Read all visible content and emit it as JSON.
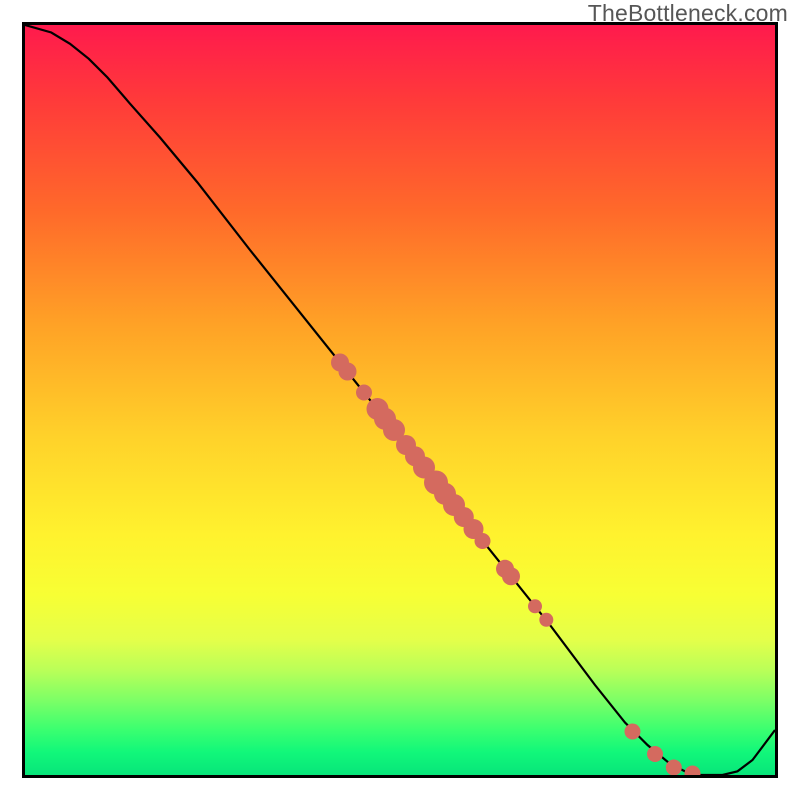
{
  "watermark": "TheBottleneck.com",
  "chart_data": {
    "type": "line",
    "title": "",
    "xlabel": "",
    "ylabel": "",
    "xlim": [
      0,
      1
    ],
    "ylim": [
      0,
      1
    ],
    "curve": [
      {
        "x": 0.0,
        "y": 1.0
      },
      {
        "x": 0.035,
        "y": 0.99
      },
      {
        "x": 0.06,
        "y": 0.975
      },
      {
        "x": 0.085,
        "y": 0.955
      },
      {
        "x": 0.11,
        "y": 0.93
      },
      {
        "x": 0.14,
        "y": 0.895
      },
      {
        "x": 0.18,
        "y": 0.85
      },
      {
        "x": 0.23,
        "y": 0.79
      },
      {
        "x": 0.3,
        "y": 0.7
      },
      {
        "x": 0.4,
        "y": 0.575
      },
      {
        "x": 0.5,
        "y": 0.45
      },
      {
        "x": 0.6,
        "y": 0.325
      },
      {
        "x": 0.7,
        "y": 0.2
      },
      {
        "x": 0.76,
        "y": 0.12
      },
      {
        "x": 0.8,
        "y": 0.07
      },
      {
        "x": 0.83,
        "y": 0.04
      },
      {
        "x": 0.86,
        "y": 0.015
      },
      {
        "x": 0.88,
        "y": 0.005
      },
      {
        "x": 0.9,
        "y": 0.0
      },
      {
        "x": 0.93,
        "y": 0.0
      },
      {
        "x": 0.95,
        "y": 0.005
      },
      {
        "x": 0.97,
        "y": 0.02
      },
      {
        "x": 0.985,
        "y": 0.04
      },
      {
        "x": 1.0,
        "y": 0.06
      }
    ],
    "points_group_a": [
      {
        "x": 0.42,
        "y": 0.55,
        "r": 9
      },
      {
        "x": 0.43,
        "y": 0.538,
        "r": 9
      },
      {
        "x": 0.452,
        "y": 0.51,
        "r": 8
      },
      {
        "x": 0.47,
        "y": 0.488,
        "r": 11
      },
      {
        "x": 0.48,
        "y": 0.475,
        "r": 11
      },
      {
        "x": 0.492,
        "y": 0.46,
        "r": 11
      },
      {
        "x": 0.508,
        "y": 0.44,
        "r": 10
      },
      {
        "x": 0.52,
        "y": 0.425,
        "r": 10
      },
      {
        "x": 0.532,
        "y": 0.41,
        "r": 11
      },
      {
        "x": 0.548,
        "y": 0.39,
        "r": 12
      },
      {
        "x": 0.56,
        "y": 0.375,
        "r": 11
      },
      {
        "x": 0.572,
        "y": 0.36,
        "r": 11
      },
      {
        "x": 0.585,
        "y": 0.344,
        "r": 10
      },
      {
        "x": 0.598,
        "y": 0.328,
        "r": 10
      },
      {
        "x": 0.61,
        "y": 0.312,
        "r": 8
      },
      {
        "x": 0.64,
        "y": 0.275,
        "r": 9
      },
      {
        "x": 0.648,
        "y": 0.265,
        "r": 9
      },
      {
        "x": 0.68,
        "y": 0.225,
        "r": 7
      },
      {
        "x": 0.695,
        "y": 0.207,
        "r": 7
      }
    ],
    "points_group_b": [
      {
        "x": 0.81,
        "y": 0.058,
        "r": 8
      },
      {
        "x": 0.84,
        "y": 0.028,
        "r": 8
      },
      {
        "x": 0.865,
        "y": 0.01,
        "r": 8
      },
      {
        "x": 0.89,
        "y": 0.002,
        "r": 8
      }
    ]
  }
}
